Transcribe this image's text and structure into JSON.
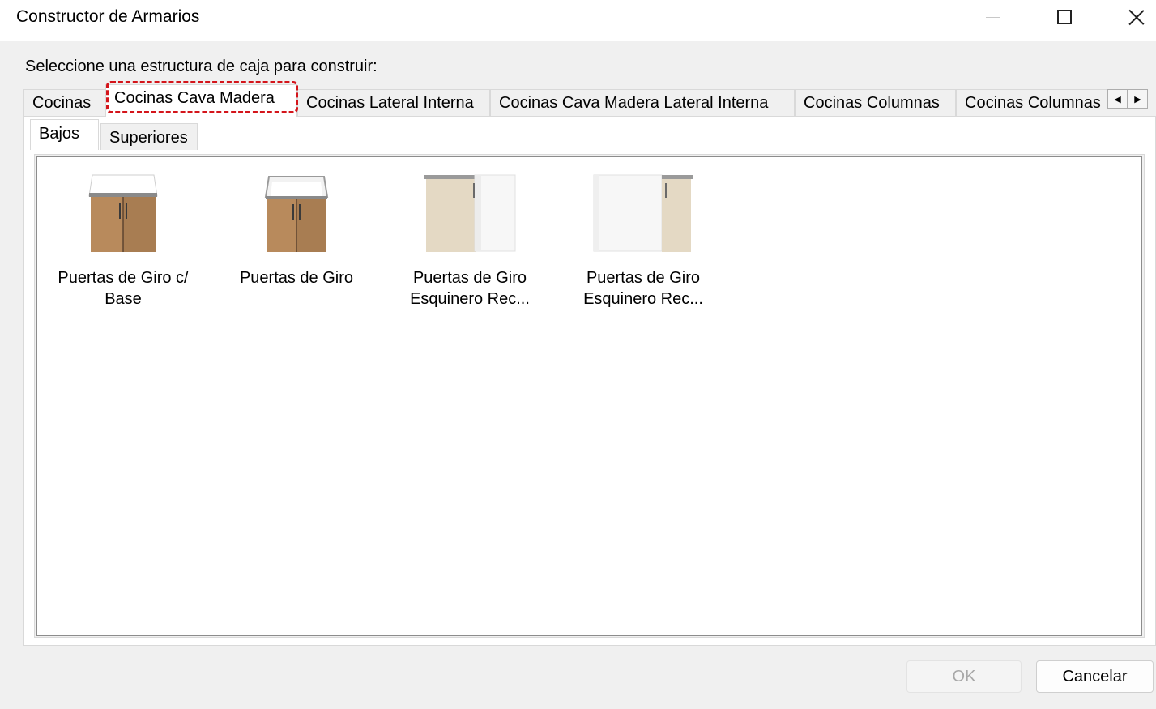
{
  "window": {
    "title": "Constructor de Armarios",
    "controls": {
      "minimize": "minimize",
      "maximize": "maximize",
      "close": "close"
    }
  },
  "instruction": "Seleccione una estructura de caja para construir:",
  "outer_tabs": [
    {
      "label": "Cocinas",
      "selected": false
    },
    {
      "label": "Cocinas Cava Madera",
      "selected": true
    },
    {
      "label": "Cocinas Lateral Interna",
      "selected": false
    },
    {
      "label": "Cocinas Cava Madera Lateral Interna",
      "selected": false
    },
    {
      "label": "Cocinas Columnas",
      "selected": false
    },
    {
      "label": "Cocinas Columnas",
      "selected": false
    }
  ],
  "tab_scroll": {
    "left_icon": "arrow-left-icon",
    "right_icon": "arrow-right-icon"
  },
  "inner_tabs": [
    {
      "label": "Bajos",
      "selected": true
    },
    {
      "label": "Superiores",
      "selected": false
    }
  ],
  "items": [
    {
      "label_line1": "Puertas de Giro c/",
      "label_line2": "Base",
      "icon": "base-cabinet-with-top-icon"
    },
    {
      "label_line1": "Puertas de Giro",
      "label_line2": "",
      "icon": "base-cabinet-open-icon"
    },
    {
      "label_line1": "Puertas de Giro",
      "label_line2": "Esquinero Rec...",
      "icon": "corner-cabinet-left-icon"
    },
    {
      "label_line1": "Puertas de Giro",
      "label_line2": "Esquinero Rec...",
      "icon": "corner-cabinet-right-icon"
    }
  ],
  "buttons": {
    "ok": "OK",
    "cancel": "Cancelar",
    "ok_enabled": false
  },
  "colors": {
    "highlight": "#d4151b",
    "wood": "#b88a5c",
    "panel": "#f3f3f3"
  }
}
